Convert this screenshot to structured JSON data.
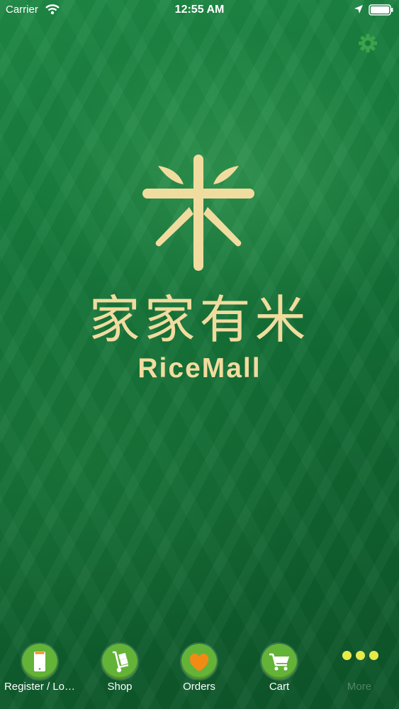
{
  "status_bar": {
    "carrier": "Carrier",
    "time": "12:55 AM"
  },
  "logo": {
    "chinese_name": "家家有米",
    "brand_name": "RiceMall"
  },
  "colors": {
    "background": "#167a3c",
    "brand_gold": "#f1dc9f",
    "tab_icon_green": "#62b338",
    "more_dots": "#e8ea4a",
    "heart_orange": "#f28b14"
  },
  "tab_bar": {
    "items": [
      {
        "label": "Register / Lo…",
        "icon": "phone-icon"
      },
      {
        "label": "Shop",
        "icon": "hand-truck-icon"
      },
      {
        "label": "Orders",
        "icon": "heart-icon"
      },
      {
        "label": "Cart",
        "icon": "shopping-cart-icon"
      },
      {
        "label": "More",
        "icon": "more-dots-icon"
      }
    ]
  }
}
